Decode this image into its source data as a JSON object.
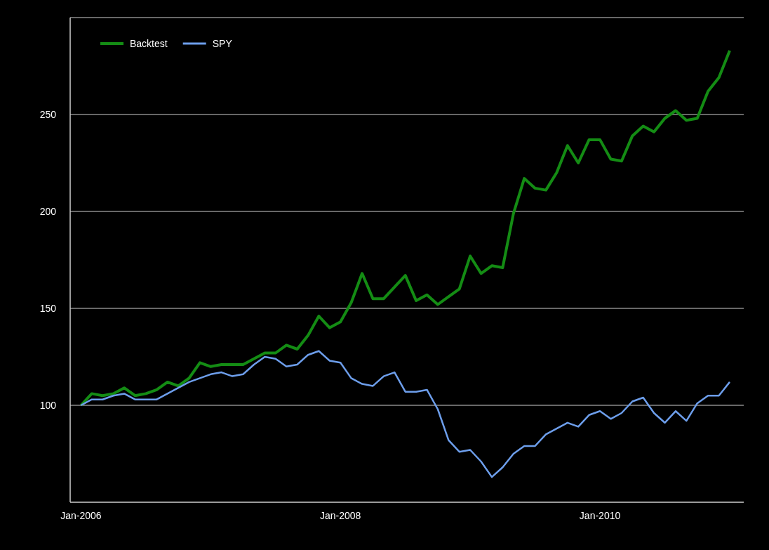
{
  "chart": {
    "chart_data": {
      "type": "line",
      "categories": [
        "Jan-2006",
        null,
        null,
        null,
        null,
        null,
        null,
        null,
        null,
        null,
        null,
        null,
        null,
        null,
        null,
        null,
        null,
        null,
        null,
        null,
        null,
        null,
        null,
        null,
        "Jan-2008",
        null,
        null,
        null,
        null,
        null,
        null,
        null,
        null,
        null,
        null,
        null,
        null,
        null,
        null,
        null,
        null,
        null,
        null,
        null,
        null,
        null,
        null,
        null,
        "Jan-2010",
        null,
        null,
        null,
        null,
        null,
        null,
        null,
        null,
        null,
        null,
        null,
        null
      ],
      "series": [
        {
          "name": "Backtest",
          "color": "#148c14",
          "values": [
            100,
            106,
            105,
            106,
            109,
            105,
            106,
            108,
            112,
            110,
            114,
            122,
            120,
            121,
            121,
            121,
            124,
            127,
            127,
            131,
            129,
            136,
            146,
            140,
            143,
            153,
            168,
            155,
            155,
            161,
            167,
            154,
            157,
            152,
            156,
            160,
            177,
            168,
            172,
            171,
            199,
            217,
            212,
            211,
            220,
            234,
            225,
            237,
            237,
            227,
            226,
            239,
            244,
            241,
            248,
            252,
            247,
            248,
            262,
            269,
            283
          ]
        },
        {
          "name": "SPY",
          "color": "#6d9eeb",
          "values": [
            100,
            103,
            103,
            105,
            106,
            103,
            103,
            103,
            106,
            109,
            112,
            114,
            116,
            117,
            115,
            116,
            121,
            125,
            124,
            120,
            121,
            126,
            128,
            123,
            122,
            114,
            111,
            110,
            115,
            117,
            107,
            107,
            108,
            98,
            82,
            76,
            77,
            71,
            63,
            68,
            75,
            79,
            79,
            85,
            88,
            91,
            89,
            95,
            97,
            93,
            96,
            102,
            104,
            96,
            91,
            97,
            92,
            101,
            105,
            105,
            112
          ]
        }
      ],
      "ylim": [
        50,
        300
      ],
      "grid": "y",
      "legend": true,
      "yticks": [
        100,
        150,
        200,
        250
      ]
    }
  }
}
